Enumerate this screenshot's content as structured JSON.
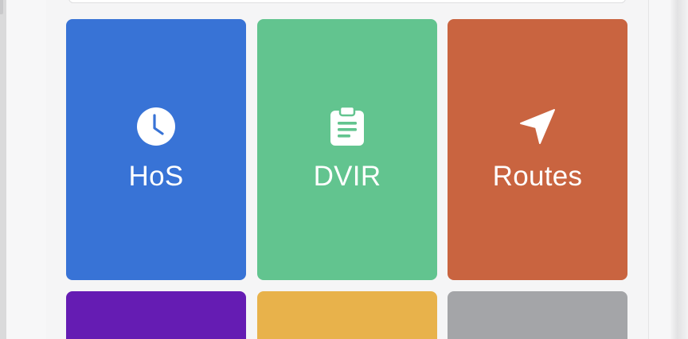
{
  "tiles": [
    {
      "label": "HoS",
      "icon": "clock-icon",
      "color": "#3873d6"
    },
    {
      "label": "DVIR",
      "icon": "clipboard-icon",
      "color": "#62c48f"
    },
    {
      "label": "Routes",
      "icon": "navigation-arrow-icon",
      "color": "#c96440"
    },
    {
      "label": "",
      "icon": "",
      "color": "#651cb3"
    },
    {
      "label": "",
      "icon": "",
      "color": "#e8b24b"
    },
    {
      "label": "",
      "icon": "",
      "color": "#a4a5a8"
    }
  ]
}
